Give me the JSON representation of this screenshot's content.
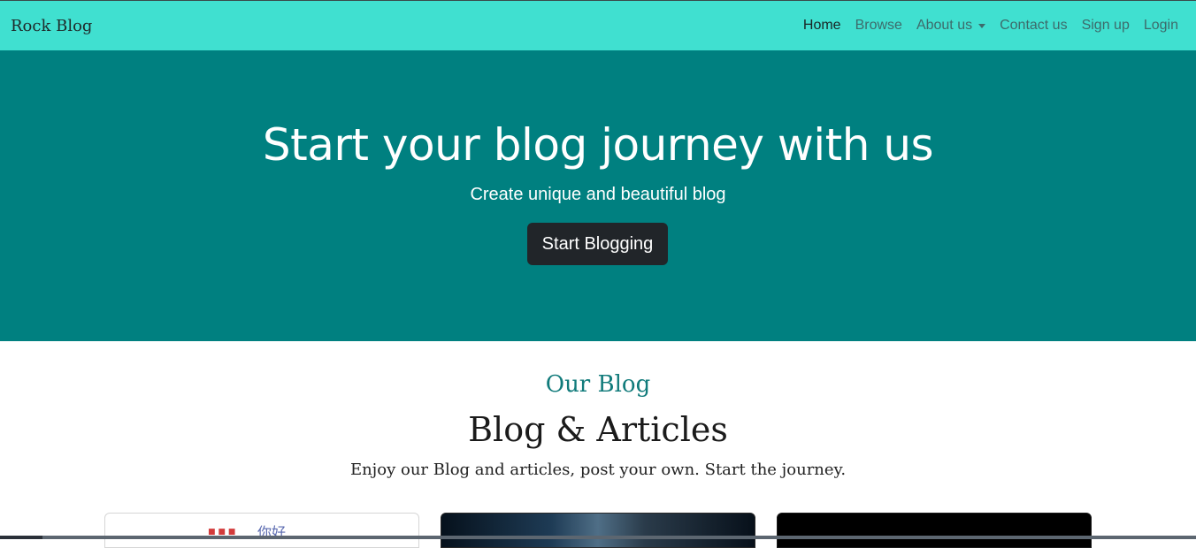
{
  "navbar": {
    "brand": "Rock Blog",
    "links": [
      {
        "label": "Home",
        "active": true
      },
      {
        "label": "Browse"
      },
      {
        "label": "About us",
        "dropdown": true
      },
      {
        "label": "Contact us"
      },
      {
        "label": "Sign up"
      },
      {
        "label": "Login"
      }
    ],
    "background_color": "#40e0d0"
  },
  "hero": {
    "title": "Start your blog journey with us",
    "subtitle": "Create unique and beautiful blog",
    "button_label": "Start Blogging",
    "background_color": "#008080"
  },
  "blog_section": {
    "eyebrow": "Our Blog",
    "title": "Blog & Articles",
    "lead": "Enjoy our Blog and articles, post your own. Start the journey.",
    "accent_color": "#117b7b"
  },
  "cards": [
    {
      "image_text": "你好"
    },
    {
      "image_text": ""
    },
    {
      "image_text": ""
    }
  ]
}
